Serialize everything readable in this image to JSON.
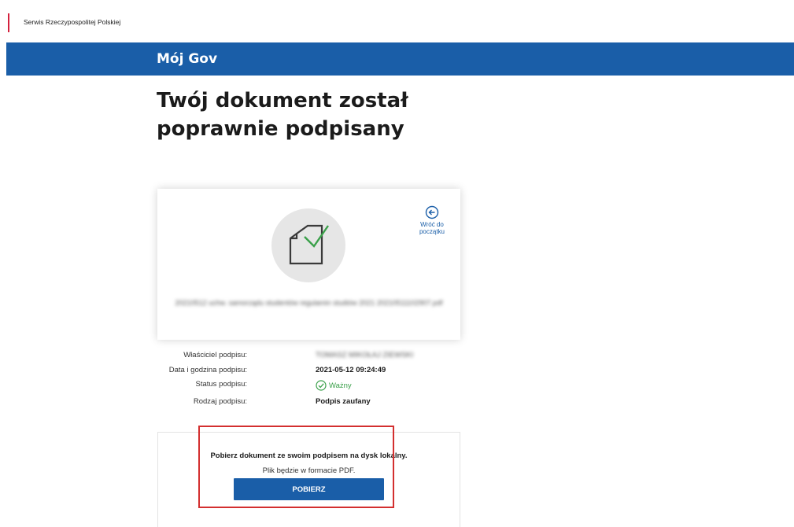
{
  "header": {
    "service_name": "Serwis Rzeczypospolitej Polskiej"
  },
  "brand": {
    "name": "Mój Gov"
  },
  "page": {
    "title": "Twój dokument został poprawnie podpisany"
  },
  "card": {
    "back_label": "Wróć do początku",
    "file_name": "20210512 uchw. samorządu studentów regulamin studiów 2021 20210511102907.pdf",
    "icon": "signed-document-icon"
  },
  "details": {
    "owner_label": "Właściciel podpisu:",
    "owner_value": "TOMASZ MIKOŁAJ ZIEWSKI",
    "datetime_label": "Data i godzina podpisu:",
    "datetime_value": "2021-05-12 09:24:49",
    "status_label": "Status podpisu:",
    "status_value": "Ważny",
    "type_label": "Rodzaj podpisu:",
    "type_value": "Podpis zaufany"
  },
  "download": {
    "title": "Pobierz dokument ze swoim podpisem na dysk lokalny.",
    "subtitle": "Plik będzie w formacie PDF.",
    "button_label": "POBIERZ"
  },
  "colors": {
    "brand_blue": "#1a5ea8",
    "success_green": "#3aa04a",
    "highlight_red": "#d32f2f"
  }
}
